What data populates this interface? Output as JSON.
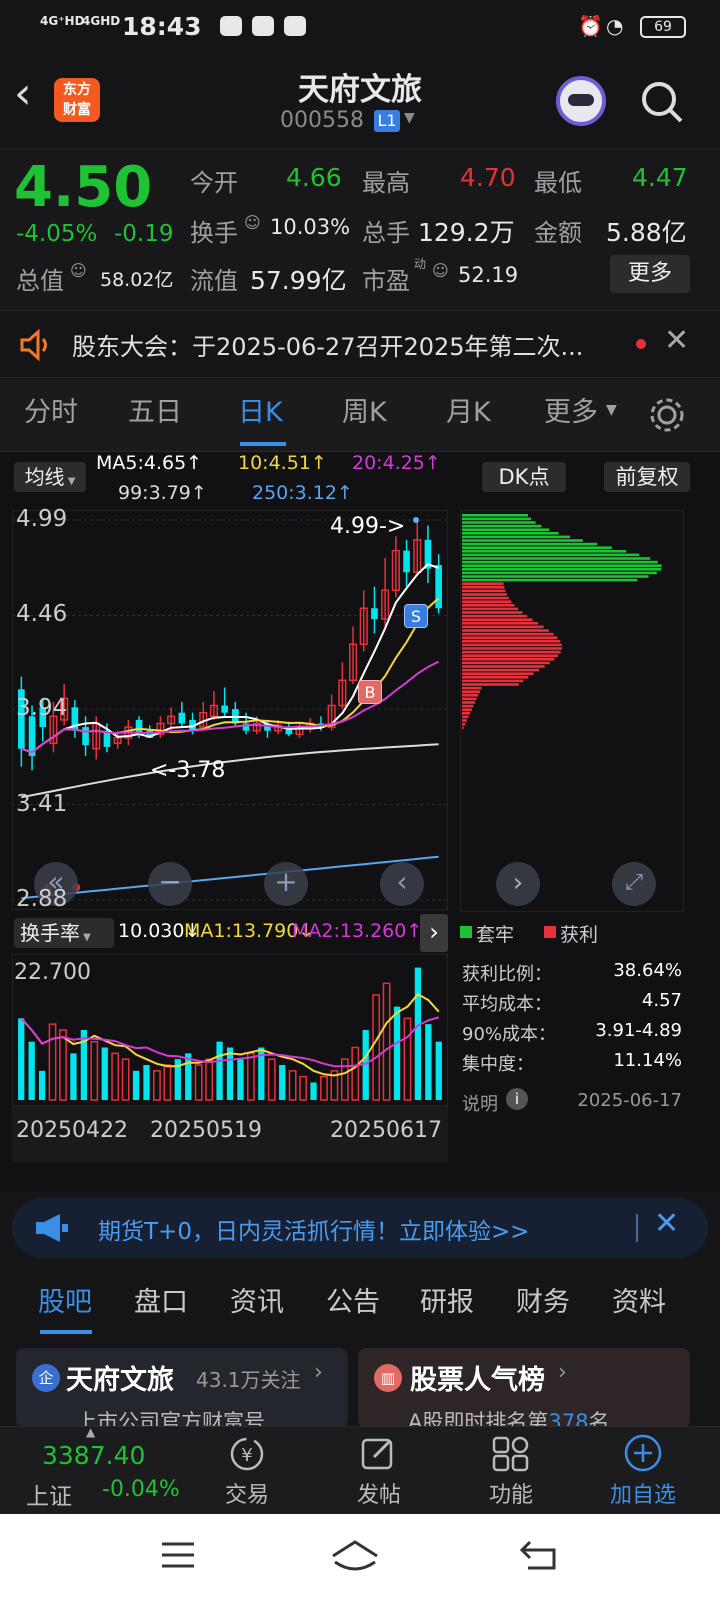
{
  "status": {
    "signal1": "4G⁺HD",
    "signal2": "4GHD",
    "time": "18:43",
    "battery": "69"
  },
  "header": {
    "logo_line1": "东方",
    "logo_line2": "财富",
    "title": "天府文旅",
    "code": "000558",
    "level": "L1"
  },
  "quote": {
    "price": "4.50",
    "change_pct": "-4.05%",
    "change": "-0.19",
    "open_label": "今开",
    "open": "4.66",
    "high_label": "最高",
    "high": "4.70",
    "low_label": "最低",
    "low": "4.47",
    "turnover_label": "换手",
    "turnover": "10.03%",
    "volume_label": "总手",
    "volume": "129.2万",
    "amount_label": "金额",
    "amount": "5.88亿",
    "mcap_label": "总值",
    "mcap": "58.02亿",
    "float_label": "流值",
    "float": "57.99亿",
    "pe_label": "市盈",
    "pe_sup": "动",
    "pe": "52.19",
    "more": "更多"
  },
  "notice": {
    "text": "股东大会：于2025-06-27召开2025年第二次..."
  },
  "tabs": [
    "分时",
    "五日",
    "日K",
    "周K",
    "月K",
    "更多"
  ],
  "active_tab": "日K",
  "chart_data": {
    "type": "candlestick",
    "controls": {
      "ma_button": "均线",
      "dk_button": "DK点",
      "adjust_button": "前复权"
    },
    "ma_legend": {
      "ma5": "MA5:4.65↑",
      "ma10": "10:4.51↑",
      "ma20": "20:4.25↑",
      "ma99": "99:3.79↑",
      "ma250": "250:3.12↑"
    },
    "y_ticks": [
      "4.99",
      "4.46",
      "3.94",
      "3.41",
      "2.88"
    ],
    "ylim": [
      2.88,
      4.99
    ],
    "high_annotation": "4.99->",
    "low_annotation": "<-3.78",
    "markers": [
      "S",
      "B"
    ],
    "candles": [
      [
        4.05,
        3.72,
        4.12,
        3.62
      ],
      [
        3.9,
        3.68,
        3.96,
        3.6
      ],
      [
        3.95,
        3.84,
        4.0,
        3.76
      ],
      [
        3.75,
        3.9,
        3.98,
        3.7
      ],
      [
        3.88,
        4.0,
        4.08,
        3.85
      ],
      [
        3.95,
        3.82,
        3.99,
        3.78
      ],
      [
        3.84,
        3.74,
        3.9,
        3.68
      ],
      [
        3.72,
        3.86,
        3.9,
        3.66
      ],
      [
        3.82,
        3.73,
        3.86,
        3.7
      ],
      [
        3.75,
        3.78,
        3.82,
        3.72
      ],
      [
        3.78,
        3.84,
        3.88,
        3.74
      ],
      [
        3.88,
        3.8,
        3.9,
        3.78
      ],
      [
        3.82,
        3.78,
        3.85,
        3.78
      ],
      [
        3.8,
        3.86,
        3.9,
        3.78
      ],
      [
        3.86,
        3.9,
        3.95,
        3.82
      ],
      [
        3.92,
        3.86,
        3.98,
        3.84
      ],
      [
        3.88,
        3.82,
        3.92,
        3.8
      ],
      [
        3.84,
        3.92,
        3.98,
        3.82
      ],
      [
        3.9,
        3.96,
        4.04,
        3.88
      ],
      [
        3.96,
        3.92,
        4.06,
        3.9
      ],
      [
        3.94,
        3.86,
        3.98,
        3.84
      ],
      [
        3.86,
        3.82,
        3.92,
        3.8
      ],
      [
        3.82,
        3.86,
        3.9,
        3.8
      ],
      [
        3.86,
        3.82,
        3.88,
        3.78
      ],
      [
        3.82,
        3.85,
        3.88,
        3.8
      ],
      [
        3.84,
        3.8,
        3.87,
        3.79
      ],
      [
        3.8,
        3.83,
        3.86,
        3.78
      ],
      [
        3.83,
        3.86,
        3.89,
        3.81
      ],
      [
        3.86,
        3.84,
        3.9,
        3.82
      ],
      [
        3.84,
        3.96,
        4.02,
        3.82
      ],
      [
        3.96,
        4.1,
        4.2,
        3.94
      ],
      [
        4.1,
        4.3,
        4.4,
        4.08
      ],
      [
        4.3,
        4.5,
        4.6,
        4.26
      ],
      [
        4.5,
        4.44,
        4.62,
        4.36
      ],
      [
        4.44,
        4.6,
        4.78,
        4.4
      ],
      [
        4.6,
        4.82,
        4.9,
        4.56
      ],
      [
        4.82,
        4.7,
        4.88,
        4.62
      ],
      [
        4.7,
        4.88,
        4.99,
        4.68
      ],
      [
        4.88,
        4.72,
        4.96,
        4.64
      ],
      [
        4.74,
        4.5,
        4.8,
        4.47
      ]
    ],
    "volume_panel": {
      "label": "换手率",
      "value": "10.030↓",
      "ma1": "MA1:13.790↓",
      "ma2": "MA2:13.260↑",
      "y_tick": "22.700",
      "values": [
        14,
        10,
        5,
        13,
        12,
        8,
        12,
        10,
        9,
        8,
        7,
        5,
        6,
        5,
        6,
        7,
        8,
        6,
        7,
        10,
        9,
        7,
        8,
        9,
        7,
        6,
        5,
        4,
        3,
        4,
        5,
        7,
        9,
        12,
        18,
        20,
        16,
        14,
        22.7,
        13,
        10
      ]
    },
    "x_ticks": [
      "20250422",
      "20250519",
      "20250617"
    ]
  },
  "chip": {
    "legend_trap": "套牢",
    "legend_profit": "获利",
    "rows": [
      [
        "获利比例：",
        "38.64%"
      ],
      [
        "平均成本：",
        "4.57"
      ],
      [
        "90%成本：",
        "3.91-4.89"
      ],
      [
        "集中度：",
        "11.14%"
      ]
    ],
    "note_label": "说明",
    "date": "2025-06-17"
  },
  "banner": {
    "text": "期货T+0，日内灵活抓行情！立即体验>>"
  },
  "subtabs": [
    "股吧",
    "盘口",
    "资讯",
    "公告",
    "研报",
    "财务",
    "资料"
  ],
  "cards": [
    {
      "title": "天府文旅",
      "meta": "43.1万关注",
      "sub": "上市公司官方财富号"
    },
    {
      "title": "股票人气榜",
      "sub_pre": "A股即时排名第",
      "sub_num": "378",
      "sub_post": "名"
    }
  ],
  "bottom": {
    "index_value": "3387.40",
    "index_name": "上证",
    "index_change": "-0.04%",
    "trade": "交易",
    "post": "发帖",
    "func": "功能",
    "add": "加自选"
  },
  "colors": {
    "up": "#e8303a",
    "down": "#1fc233",
    "cyan": "#00e5ee",
    "accent": "#3a8ee6"
  }
}
